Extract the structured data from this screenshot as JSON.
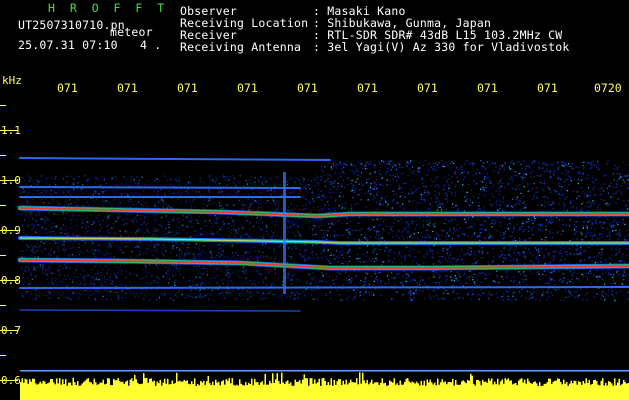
{
  "header": {
    "title": "H R O F F T",
    "filename": "UT2507310710.pn",
    "mode": "meteor",
    "datetime": "25.07.31 07:10",
    "count": "4 .",
    "info_labels": [
      "Observer",
      "Receiving Location",
      "Receiver",
      "Receiving Antenna"
    ],
    "info_values": [
      ": Masaki Kano",
      ": Shibukawa, Gunma, Japan",
      ": RTL-SDR SDR# 43dB L15 103.2MHz CW",
      ": 3el Yagi(V) Az 330 for Vladivostok"
    ]
  },
  "time_axis": {
    "labels": [
      "071",
      "071",
      "071",
      "071",
      "071",
      "071",
      "071",
      "071",
      "071",
      "0720"
    ]
  },
  "freq_axis": {
    "unit": "kHz",
    "labels": [
      "1.1",
      "1.0",
      "0.9",
      "0.8",
      "0.7",
      "0.6"
    ]
  },
  "colors": {
    "header_text": "#ffffff",
    "title": "#3fe03f",
    "axis": "#ffff60",
    "background": "#000000",
    "baseline_line": "#5aa0ff"
  }
}
